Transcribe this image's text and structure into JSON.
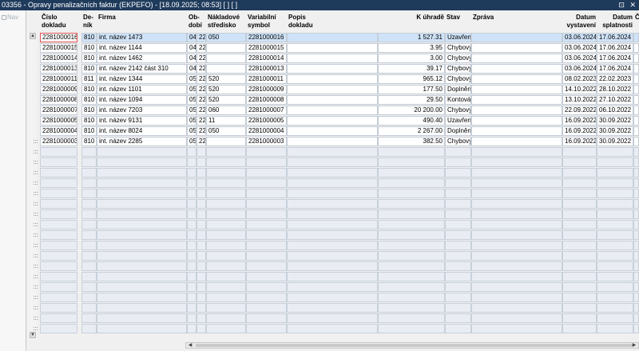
{
  "window": {
    "title": "03356 - Opravy penalizačních faktur (EKPEFO) - [18.09.2025; 08:53]  [ ]  [ ]",
    "buttons": "⊡ ✕"
  },
  "nav": {
    "label": "Nav"
  },
  "columns": [
    {
      "key": "cislo",
      "label": "Číslo\ndokladu",
      "align": "left"
    },
    {
      "key": "denik",
      "label": "De-\nník",
      "align": "left"
    },
    {
      "key": "firma",
      "label": "Firma",
      "align": "left"
    },
    {
      "key": "obdobi",
      "label": "Ob-\ndobí",
      "align": "left"
    },
    {
      "key": "rok",
      "label": "",
      "align": "left"
    },
    {
      "key": "stredisko",
      "label": "Nákladové\nstředisko",
      "align": "left"
    },
    {
      "key": "vs",
      "label": "Variabilní\nsymbol",
      "align": "left"
    },
    {
      "key": "popis",
      "label": "Popis\ndokladu",
      "align": "left"
    },
    {
      "key": "kuhrade",
      "label": "K úhradě",
      "align": "right"
    },
    {
      "key": "stav",
      "label": "Stav",
      "align": "left"
    },
    {
      "key": "zprava",
      "label": "Zpráva",
      "align": "left"
    },
    {
      "key": "vystaveni",
      "label": "Datum\nvystavení",
      "align": "right"
    },
    {
      "key": "splatnost",
      "label": "Datum\nsplatnosti",
      "align": "right"
    },
    {
      "key": "extra",
      "label": "Č",
      "align": "left"
    }
  ],
  "rows": [
    {
      "cislo": "2281000016",
      "denik": "810",
      "firma": "int. název 1473",
      "obdobi": "04",
      "rok": "22",
      "stredisko": "050",
      "vs": "2281000016",
      "popis": "",
      "kuhrade": "1 527.31",
      "stav": "Uzavřen",
      "zprava": "",
      "vystaveni": "03.06.2024",
      "splatnost": "17.06.2024",
      "extra": ""
    },
    {
      "cislo": "2281000015",
      "denik": "810",
      "firma": "int. název 1144",
      "obdobi": "04",
      "rok": "22",
      "stredisko": "",
      "vs": "2281000015",
      "popis": "",
      "kuhrade": "3.95",
      "stav": "Chybový",
      "zprava": "",
      "vystaveni": "03.06.2024",
      "splatnost": "17.06.2024",
      "extra": ""
    },
    {
      "cislo": "2281000014",
      "denik": "810",
      "firma": "int. název 1462",
      "obdobi": "04",
      "rok": "22",
      "stredisko": "",
      "vs": "2281000014",
      "popis": "",
      "kuhrade": "3.00",
      "stav": "Chybový",
      "zprava": "",
      "vystaveni": "03.06.2024",
      "splatnost": "17.06.2024",
      "extra": ""
    },
    {
      "cislo": "2281000013",
      "denik": "810",
      "firma": "int. název 2142 část 310",
      "obdobi": "04",
      "rok": "22",
      "stredisko": "",
      "vs": "2281000013",
      "popis": "",
      "kuhrade": "39.17",
      "stav": "Chybový",
      "zprava": "",
      "vystaveni": "03.06.2024",
      "splatnost": "17.06.2024",
      "extra": ""
    },
    {
      "cislo": "2281000011",
      "denik": "811",
      "firma": "int. název 1344",
      "obdobi": "05",
      "rok": "22",
      "stredisko": "520",
      "vs": "2281000011",
      "popis": "",
      "kuhrade": "965.12",
      "stav": "Chybový",
      "zprava": "",
      "vystaveni": "08.02.2023",
      "splatnost": "22.02.2023",
      "extra": ""
    },
    {
      "cislo": "2281000009",
      "denik": "810",
      "firma": "int. název 1101",
      "obdobi": "05",
      "rok": "22",
      "stredisko": "520",
      "vs": "2281000009",
      "popis": "",
      "kuhrade": "177.50",
      "stav": "Doplněn",
      "zprava": "",
      "vystaveni": "14.10.2022",
      "splatnost": "28.10.2022",
      "extra": ""
    },
    {
      "cislo": "2281000008",
      "denik": "810",
      "firma": "int. název 1094",
      "obdobi": "05",
      "rok": "22",
      "stredisko": "520",
      "vs": "2281000008",
      "popis": "",
      "kuhrade": "29.50",
      "stav": "Kontovár",
      "zprava": "",
      "vystaveni": "13.10.2022",
      "splatnost": "27.10.2022",
      "extra": ""
    },
    {
      "cislo": "2281000007",
      "denik": "810",
      "firma": "int. název 7203",
      "obdobi": "05",
      "rok": "22",
      "stredisko": "060",
      "vs": "2281000007",
      "popis": "",
      "kuhrade": "20 200.00",
      "stav": "Chybový",
      "zprava": "",
      "vystaveni": "22.09.2022",
      "splatnost": "06.10.2022",
      "extra": ""
    },
    {
      "cislo": "2281000005",
      "denik": "810",
      "firma": "int. název 9131",
      "obdobi": "05",
      "rok": "22",
      "stredisko": "11",
      "vs": "2281000005",
      "popis": "",
      "kuhrade": "490.40",
      "stav": "Uzavřen",
      "zprava": "",
      "vystaveni": "16.09.2022",
      "splatnost": "30.09.2022",
      "extra": ""
    },
    {
      "cislo": "2281000004",
      "denik": "810",
      "firma": "int. název 8024",
      "obdobi": "05",
      "rok": "22",
      "stredisko": "050",
      "vs": "2281000004",
      "popis": "",
      "kuhrade": "2 267.00",
      "stav": "Doplněn",
      "zprava": "",
      "vystaveni": "16.09.2022",
      "splatnost": "30.09.2022",
      "extra": ""
    },
    {
      "cislo": "2281000003",
      "denik": "810",
      "firma": "int. název 2285",
      "obdobi": "05",
      "rok": "22",
      "stredisko": "",
      "vs": "2281000003",
      "popis": "",
      "kuhrade": "382.50",
      "stav": "Chybový",
      "zprava": "",
      "vystaveni": "16.09.2022",
      "splatnost": "30.09.2022",
      "extra": ""
    }
  ],
  "selected_row": 0,
  "scroll": {
    "up": "▲",
    "down": "▼",
    "left": "◀",
    "right": "▶"
  }
}
